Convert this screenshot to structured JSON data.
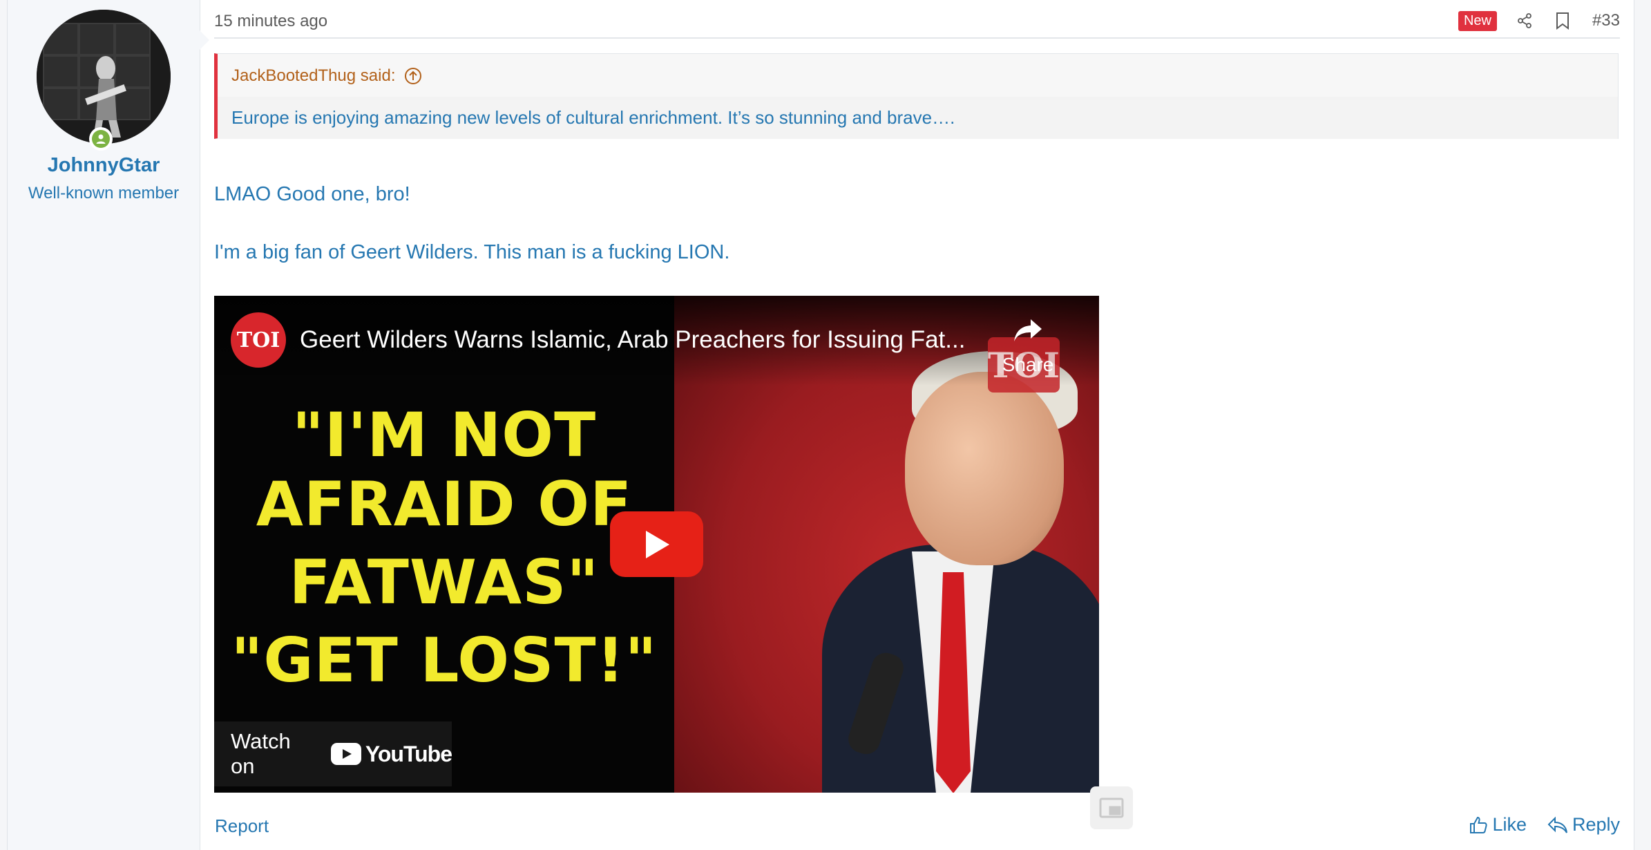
{
  "user": {
    "username": "JohnnyGtar",
    "title": "Well-known member"
  },
  "post": {
    "timestamp": "15 minutes ago",
    "new_badge": "New",
    "number": "#33",
    "quote": {
      "author_label": "JackBootedThug said:",
      "text": "Europe is enjoying amazing new levels of cultural enrichment. It’s so stunning and brave…."
    },
    "body": [
      "LMAO Good one, bro!",
      "I'm a big fan of Geert Wilders. This man is a fucking LION."
    ],
    "video": {
      "channel_logo": "TOI",
      "title": "Geert Wilders Warns Islamic, Arab Preachers for Issuing Fat...",
      "share_label": "Share",
      "watermark": "TOI",
      "headline_lines": [
        "\"I'M NOT",
        "AFRAID OF",
        "FATWAS\"",
        "\"GET LOST!\""
      ],
      "watch_on": "Watch on",
      "platform": "YouTube"
    },
    "actions": {
      "report": "Report",
      "like": "Like",
      "reply": "Reply"
    }
  },
  "colors": {
    "link": "#2577b1",
    "new_badge": "#e0313e",
    "quote_author": "#b2611a",
    "online": "#7cb342",
    "headline": "#f2ea2d"
  },
  "icons": [
    "share-icon",
    "bookmark-icon",
    "arrow-up-circle-icon",
    "play-icon",
    "picture-in-picture-icon",
    "thumbs-up-icon",
    "reply-icon",
    "user-online-icon"
  ]
}
